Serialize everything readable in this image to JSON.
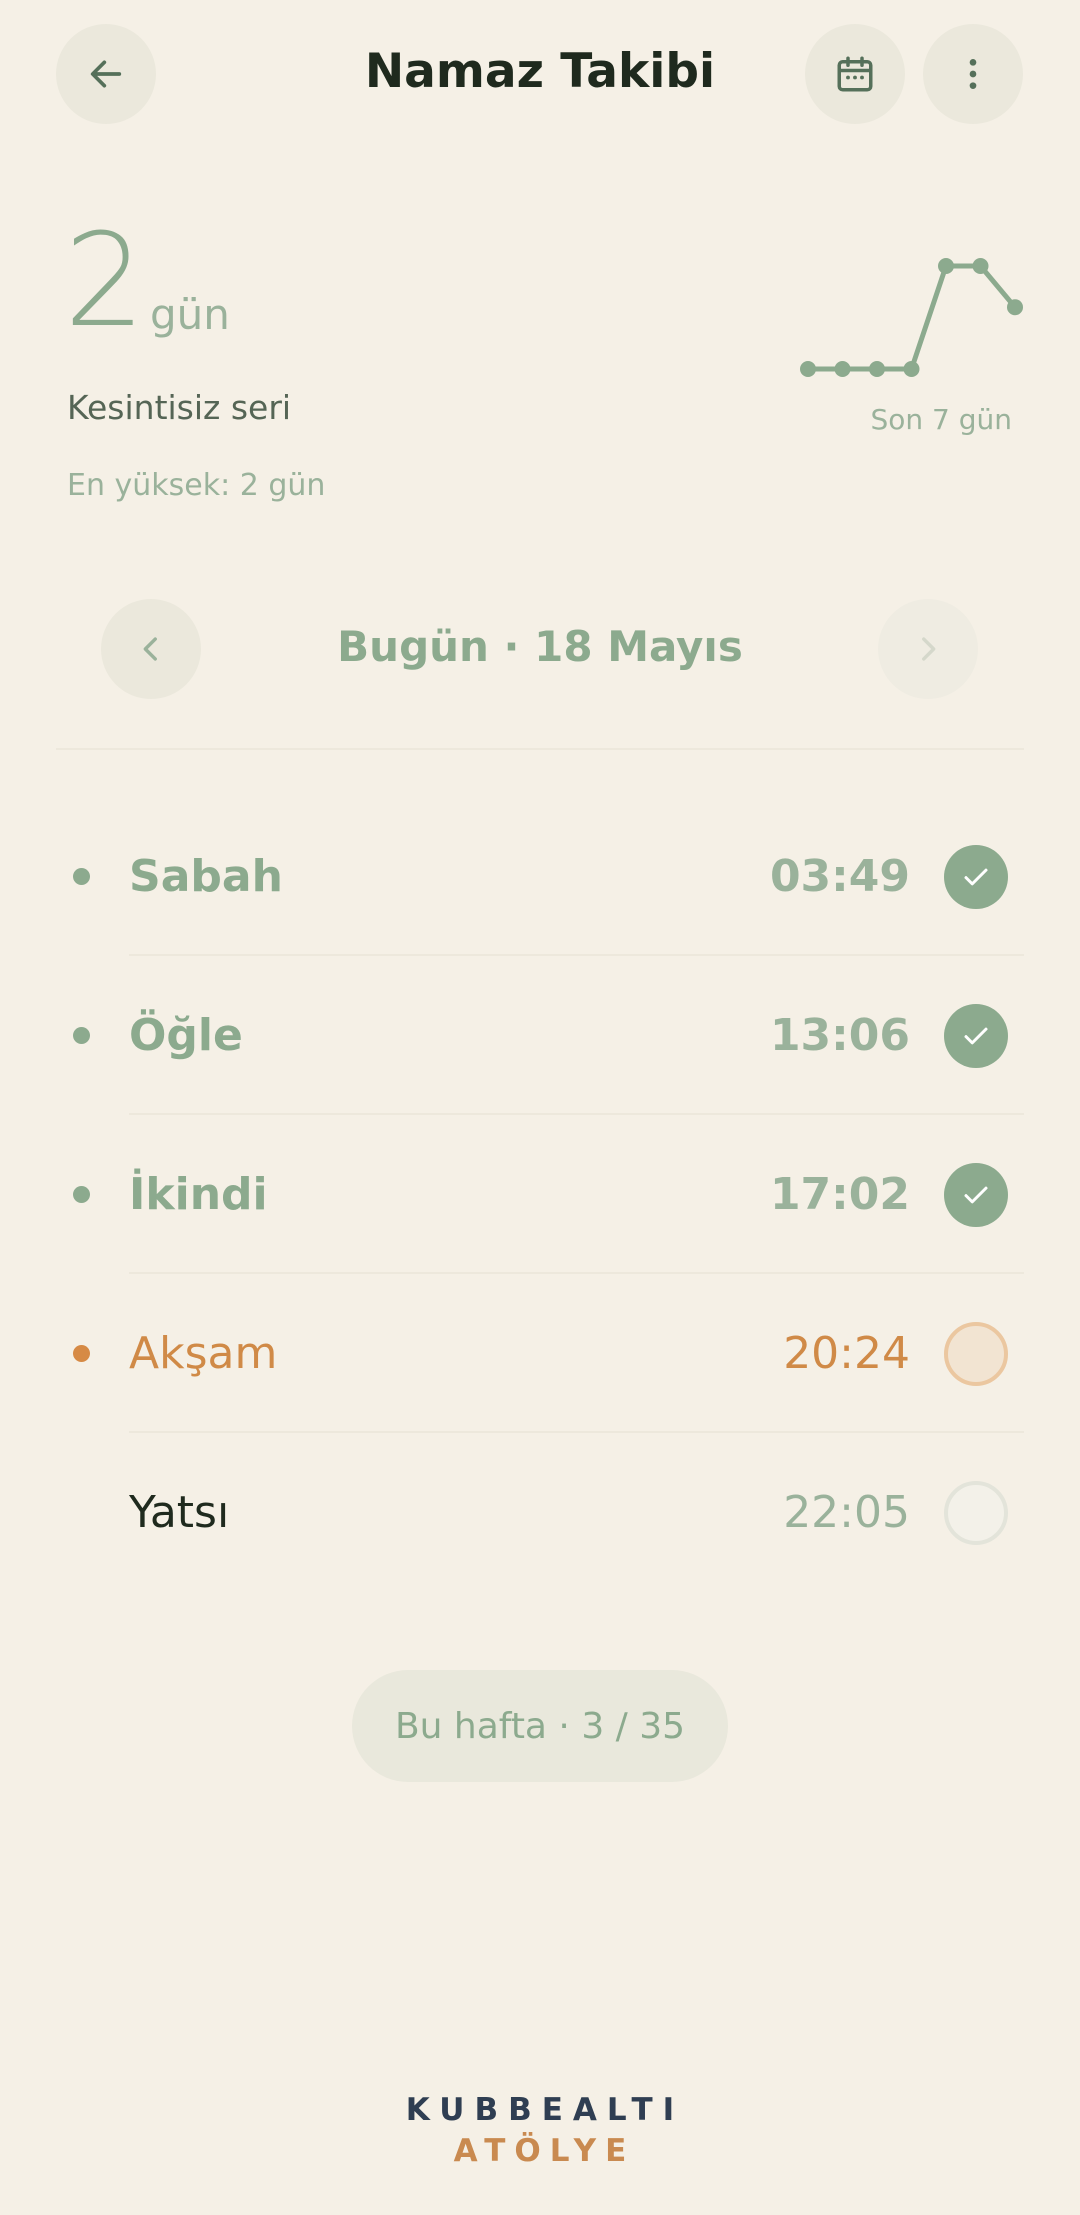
{
  "header": {
    "title": "Namaz Takibi",
    "back_icon": "arrow-left-icon",
    "calendar_icon": "calendar-icon",
    "menu_icon": "more-vertical-icon"
  },
  "streak": {
    "count": "2",
    "unit": "gün",
    "label": "Kesintisiz seri",
    "best": "En yüksek: 2 gün",
    "chart_caption": "Son 7 gün",
    "last7": [
      0,
      0,
      0,
      0,
      1,
      1,
      0.6
    ]
  },
  "date_nav": {
    "label": "Bugün · 18 Mayıs",
    "prev_icon": "chevron-left-icon",
    "next_icon": "chevron-right-icon"
  },
  "prayers": [
    {
      "name": "Sabah",
      "time": "03:49",
      "status": "done"
    },
    {
      "name": "Öğle",
      "time": "13:06",
      "status": "done"
    },
    {
      "name": "İkindi",
      "time": "17:02",
      "status": "done"
    },
    {
      "name": "Akşam",
      "time": "20:24",
      "status": "current"
    },
    {
      "name": "Yatsı",
      "time": "22:05",
      "status": "pending"
    }
  ],
  "week_summary": "Bu hafta · 3 / 35",
  "brand": {
    "line1": "KUBBEALTI",
    "line2": "ATÖLYE"
  },
  "colors": {
    "background": "#F5F0E6",
    "sage": "#8CAA8E",
    "accent_orange": "#D68A45",
    "dark_text": "#1F2A1E",
    "brand_navy": "#2F3E52"
  }
}
